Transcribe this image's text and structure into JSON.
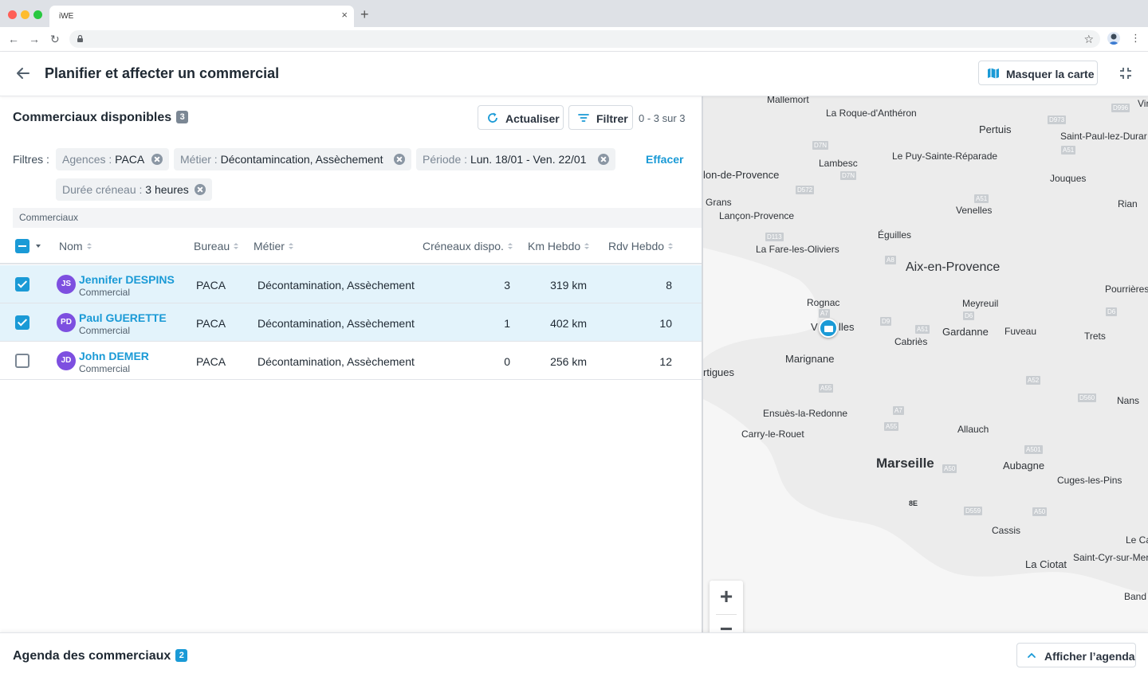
{
  "browser": {
    "tab_title": "iWE",
    "tab_close": "×",
    "new_tab": "+",
    "nav_back": "←",
    "nav_forward": "→",
    "nav_reload": "↻",
    "star": "☆",
    "menu": "⋮"
  },
  "header": {
    "title": "Planifier et affecter un commercial",
    "map_toggle_label": "Masquer la carte"
  },
  "available": {
    "title": "Commerciaux disponibles",
    "count": "3",
    "refresh_label": "Actualiser",
    "filter_label": "Filtrer",
    "pagination": "0 - 3 sur 3"
  },
  "filters": {
    "label": "Filtres :",
    "clear_label": "Effacer",
    "chips": [
      {
        "key": "Agences :",
        "value": "PACA"
      },
      {
        "key": "Métier :",
        "value": "Décontamincation, Assèchement"
      },
      {
        "key": "Période :",
        "value": "Lun. 18/01 - Ven. 22/01"
      },
      {
        "key": "Durée créneau :",
        "value": "3 heures"
      }
    ]
  },
  "table": {
    "group_label": "Commerciaux",
    "columns": {
      "name": "Nom",
      "office": "Bureau",
      "trade": "Métier",
      "slots": "Créneaux dispo.",
      "km": "Km Hebdo",
      "rdv": "Rdv Hebdo"
    },
    "rows": [
      {
        "initials": "JS",
        "name": "Jennifer DESPINS",
        "role": "Commercial",
        "office": "PACA",
        "trade": "Décontamination, Assèchement",
        "slots": "3",
        "km": "319 km",
        "rdv": "8",
        "checked": true
      },
      {
        "initials": "PD",
        "name": "Paul GUERETTE",
        "role": "Commercial",
        "office": "PACA",
        "trade": "Décontamination, Assèchement",
        "slots": "1",
        "km": "402 km",
        "rdv": "10",
        "checked": true
      },
      {
        "initials": "JD",
        "name": "John DEMER",
        "role": "Commercial",
        "office": "PACA",
        "trade": "Décontamination, Assèchement",
        "slots": "0",
        "km": "256 km",
        "rdv": "12",
        "checked": false
      }
    ]
  },
  "map": {
    "places": {
      "mallemort": "Mallemort",
      "roque": "La Roque-d'Anthéron",
      "pertuis": "Pertuis",
      "vir": "Vir",
      "st_paul": "Saint-Paul-lez-Durar",
      "lambesc": "Lambesc",
      "puy": "Le Puy-Sainte-Réparade",
      "salon": "lon-de-Provence",
      "jouques": "Jouques",
      "grans": "Grans",
      "lancon": "Lançon-Provence",
      "venelles": "Venelles",
      "rian": "Rian",
      "eguilles": "Éguilles",
      "fare": "La Fare-les-Oliviers",
      "aix": "Aix-en-Provence",
      "rognac": "Rognac",
      "meyreuil": "Meyreuil",
      "pourrieres": "Pourrières",
      "vitrolles_a": "V",
      "vitrolles_b": "lles",
      "gardanne": "Gardanne",
      "fuveau": "Fuveau",
      "cabries": "Cabriès",
      "trets": "Trets",
      "marignane": "Marignane",
      "martigues": "rtigues",
      "ensues": "Ensuès-la-Redonne",
      "nans": "Nans",
      "carry": "Carry-le-Rouet",
      "allauch": "Allauch",
      "marseille": "Marseille",
      "aubagne": "Aubagne",
      "cuges": "Cuges-les-Pins",
      "8e": "8E",
      "cassis": "Cassis",
      "le_ca": "Le Ca",
      "st_cyr": "Saint-Cyr-sur-Mer",
      "ciotat": "La Ciotat",
      "bandol": "Band"
    },
    "roads": {
      "d996": "D996",
      "d973": "D973",
      "a51a": "A51",
      "d7n1": "D7N",
      "d7n2": "D7N",
      "d572": "D572",
      "a51b": "A51",
      "d113": "D113",
      "a8": "A8",
      "a7a": "A7",
      "d6a": "D6",
      "d9": "D9",
      "d6b": "D6",
      "a51c": "A51",
      "a52": "A52",
      "a55a": "A55",
      "d560": "D560",
      "a7b": "A7",
      "a55b": "A55",
      "a501": "A501",
      "a50a": "A50",
      "d559": "D559",
      "a50b": "A50"
    },
    "zoom_in": "+",
    "zoom_out": "−"
  },
  "agenda": {
    "title": "Agenda des commerciaux",
    "count": "2",
    "show_label": "Afficher l’agenda"
  }
}
